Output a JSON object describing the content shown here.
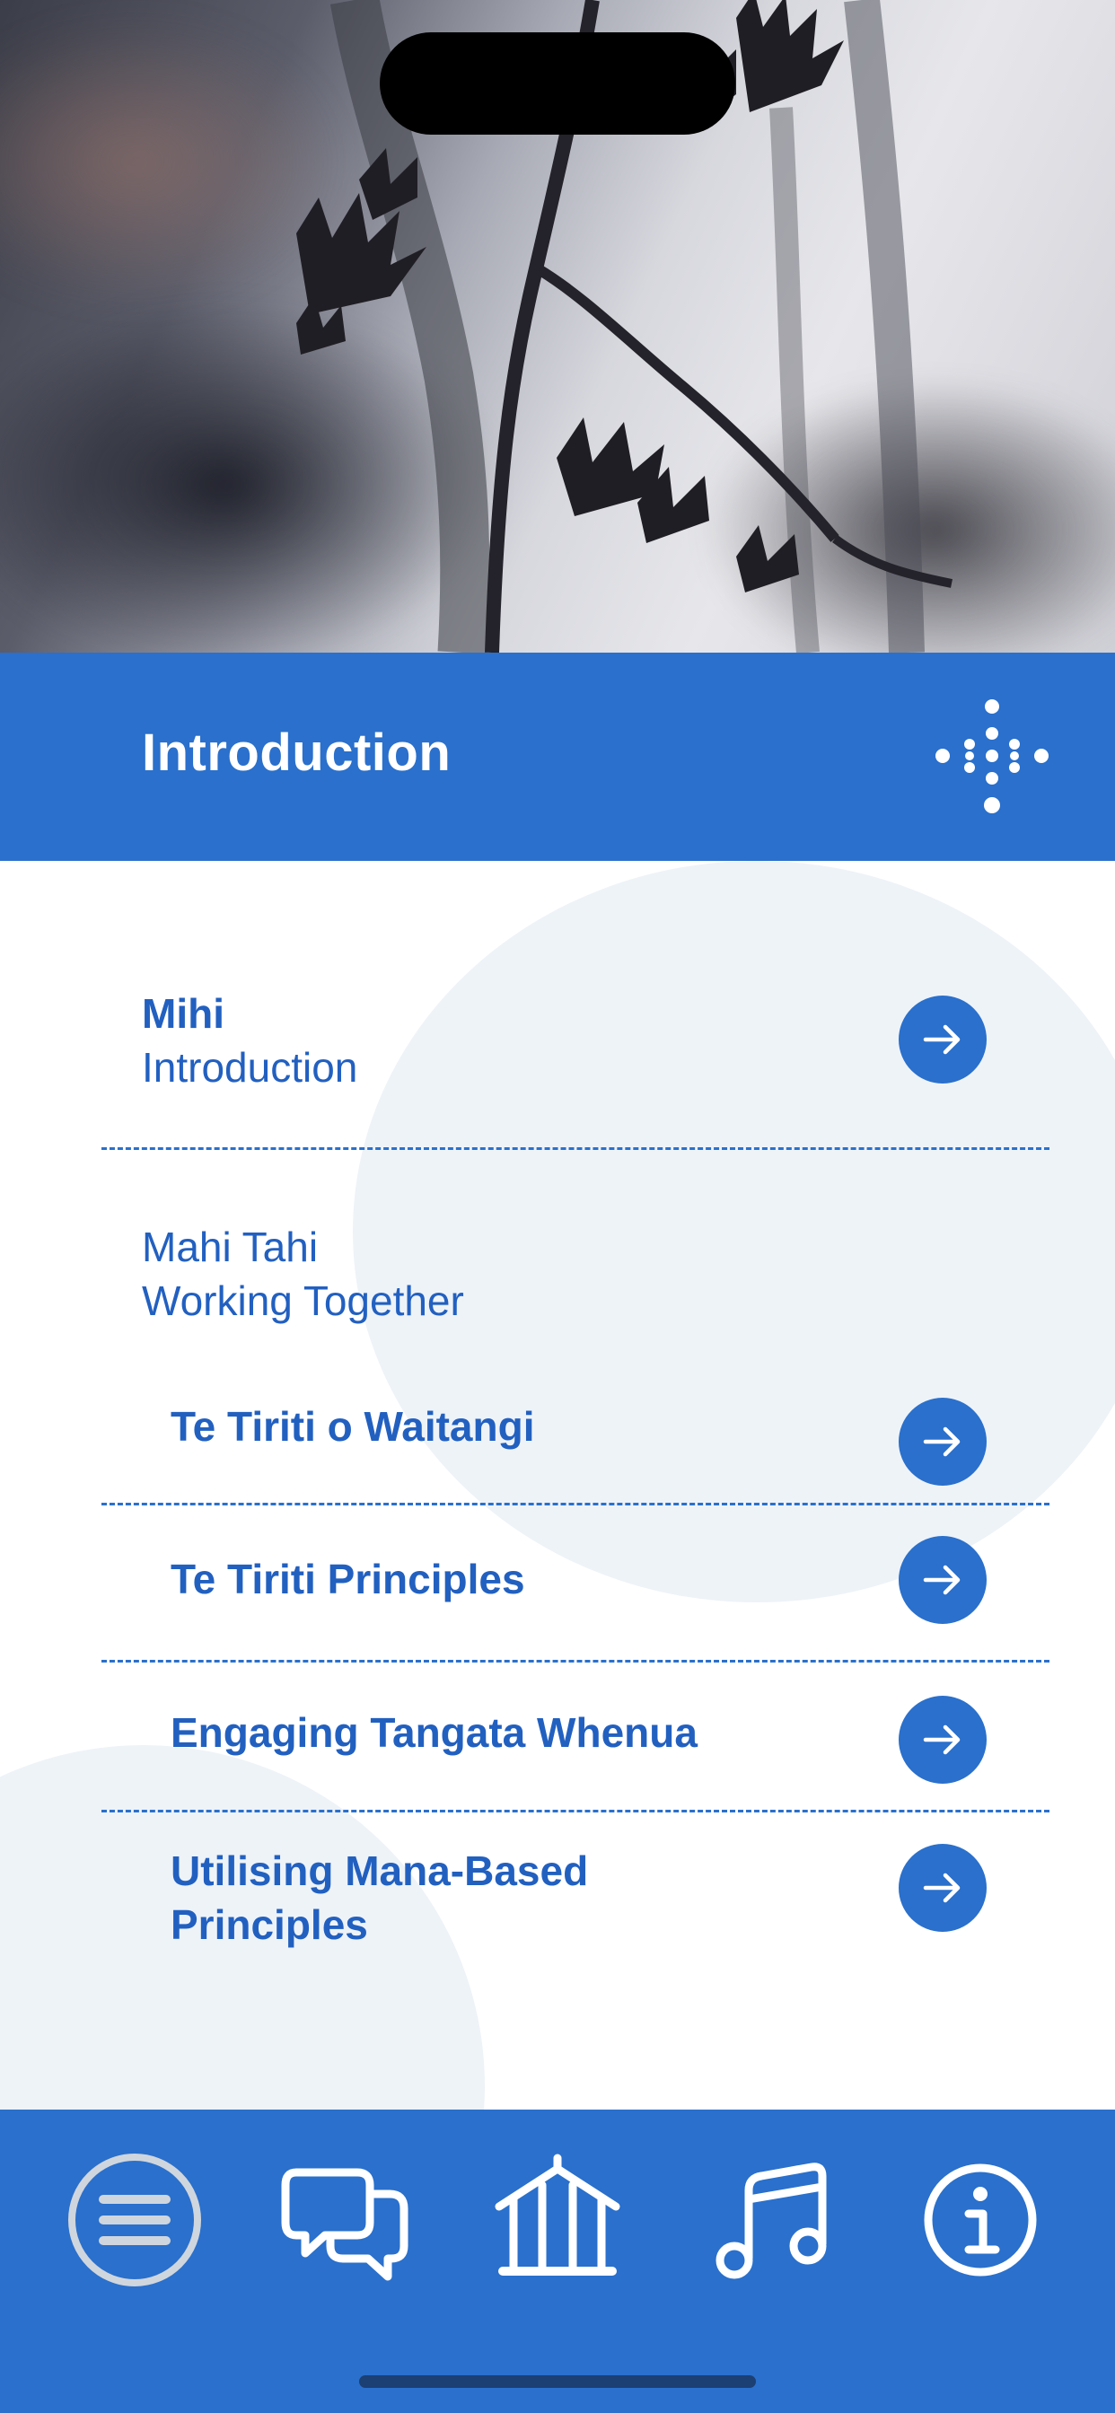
{
  "header": {
    "title": "Introduction",
    "logo_icon": "dotted-diamond-logo-icon"
  },
  "menu": {
    "items": [
      {
        "primary": "Mihi",
        "secondary": "Introduction",
        "action_icon": "arrow-right-icon"
      }
    ],
    "section": {
      "title": "Mahi Tahi",
      "subtitle": "Working Together",
      "items": [
        {
          "label": "Te Tiriti o Waitangi",
          "action_icon": "arrow-right-icon"
        },
        {
          "label": "Te Tiriti Principles",
          "action_icon": "arrow-right-icon"
        },
        {
          "label": "Engaging Tangata Whenua",
          "action_icon": "arrow-right-icon"
        },
        {
          "label_line1": "Utilising Mana-Based",
          "label_line2": "Principles",
          "action_icon": "arrow-right-icon"
        }
      ]
    }
  },
  "bottom_nav": {
    "items": [
      {
        "icon": "menu-icon",
        "active": true
      },
      {
        "icon": "chat-bubbles-icon"
      },
      {
        "icon": "meeting-house-icon"
      },
      {
        "icon": "music-note-icon"
      },
      {
        "icon": "info-icon"
      }
    ]
  },
  "colors": {
    "primary": "#2a70cc",
    "text_blue": "#2260c0",
    "light_circle": "#eef3f8",
    "white": "#ffffff"
  }
}
